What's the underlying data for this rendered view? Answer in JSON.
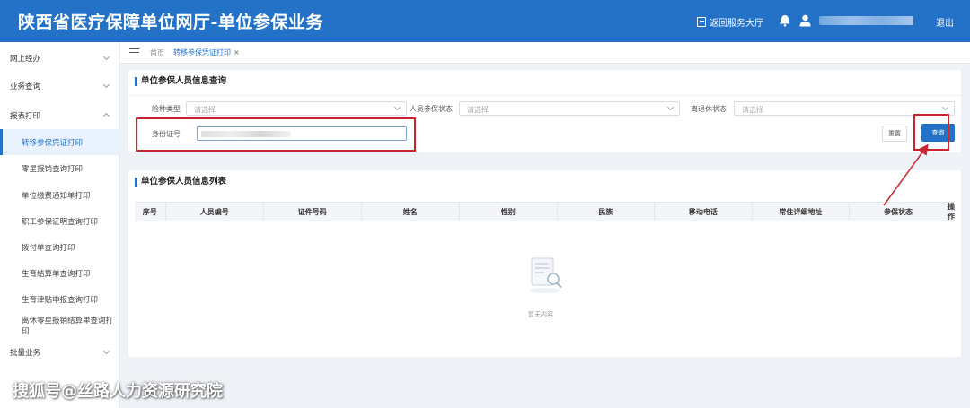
{
  "header": {
    "title": "陕西省医疗保障单位网厅-单位参保业务",
    "back_label": "返回服务大厅",
    "logout_label": "退出",
    "bg_color": "#2472c8"
  },
  "sidebar": {
    "items": [
      {
        "label": "网上经办",
        "kind": "group",
        "expanded": false
      },
      {
        "label": "业务查询",
        "kind": "group",
        "expanded": false
      },
      {
        "label": "报表打印",
        "kind": "group",
        "expanded": true
      },
      {
        "label": "转移参保凭证打印",
        "kind": "sub",
        "active": true
      },
      {
        "label": "零星报销查询打印",
        "kind": "sub"
      },
      {
        "label": "单位缴费通知单打印",
        "kind": "sub"
      },
      {
        "label": "职工参保证明查询打印",
        "kind": "sub"
      },
      {
        "label": "拨付单查询打印",
        "kind": "sub"
      },
      {
        "label": "生育结算单查询打印",
        "kind": "sub"
      },
      {
        "label": "生育津贴申报查询打印",
        "kind": "sub"
      },
      {
        "label": "离休零星报销结算单查询打印",
        "kind": "sub"
      },
      {
        "label": "批量业务",
        "kind": "group",
        "expanded": false
      }
    ]
  },
  "tabs": {
    "home": "首页",
    "active": "转移参保凭证打印",
    "close": "×"
  },
  "query_panel": {
    "title": "单位参保人员信息查询",
    "fields": {
      "insurance_type": {
        "label": "险种类型",
        "placeholder": "请选择"
      },
      "status": {
        "label": "人员参保状态",
        "placeholder": "请选择"
      },
      "retire": {
        "label": "离退休状态",
        "placeholder": "请选择"
      },
      "id_number": {
        "label": "身份证号"
      }
    },
    "reset_label": "重置",
    "query_label": "查询"
  },
  "list_panel": {
    "title": "单位参保人员信息列表",
    "columns": [
      "序号",
      "人员编号",
      "证件号码",
      "姓名",
      "性别",
      "民族",
      "移动电话",
      "常住详细地址",
      "参保状态",
      "操作"
    ],
    "empty_text": "暂无内容"
  },
  "annotation_color": "#c9252e",
  "watermark": "搜狐号@丝路人力资源研究院"
}
